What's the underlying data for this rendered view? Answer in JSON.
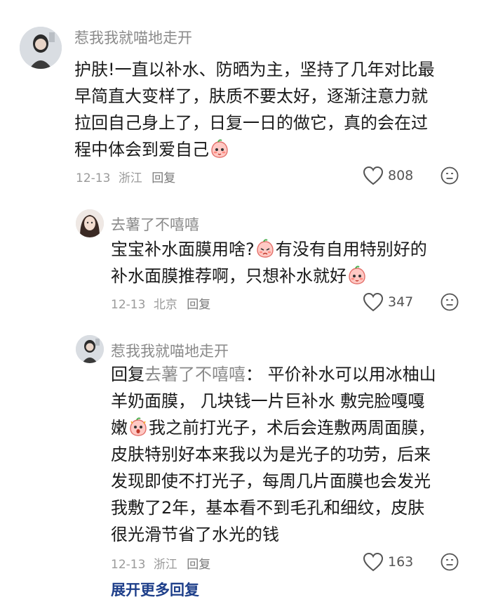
{
  "comments": [
    {
      "username": "惹我我就喵地走开",
      "lines": [
        "护肤!一直以补水、防晒为主，坚持了几年对比最",
        "早简直大变样了，肤质不要太好，逐渐注意力就",
        "拉回自己身上了，日复一日的做它，真的会在过",
        "程中体会到爱自己"
      ],
      "date": "12-13",
      "location": "浙江",
      "reply_label": "回复",
      "likes": "808"
    },
    {
      "username": "去薯了不嘻嘻",
      "lines": [
        "宝宝补水面膜用啥?",
        "有没有自用特别好的",
        "补水面膜推荐啊，只想补水就好"
      ],
      "date": "12-13",
      "location": "北京",
      "reply_label": "回复",
      "likes": "347"
    },
    {
      "username": "惹我我就喵地走开",
      "reply_prefix": "回复",
      "mention": "去薯了不嘻嘻",
      "after_mention": "：   平价补水可以用冰柚山",
      "lines": [
        "羊奶面膜，  几块钱一片巨补水  敷完脸嘎嘎",
        "嫩",
        "我之前打光子，术后会连敷两周面膜，",
        "皮肤特别好本来我以为是光子的功劳，后来",
        "发现即使不打光子，每周几片面膜也会发光",
        "我敷了2年，基本看不到毛孔和细纹，皮肤",
        "很光滑节省了水光的钱"
      ],
      "date": "12-13",
      "location": "浙江",
      "reply_label": "回复",
      "likes": "163"
    }
  ],
  "expand_label": "展开更多回复"
}
